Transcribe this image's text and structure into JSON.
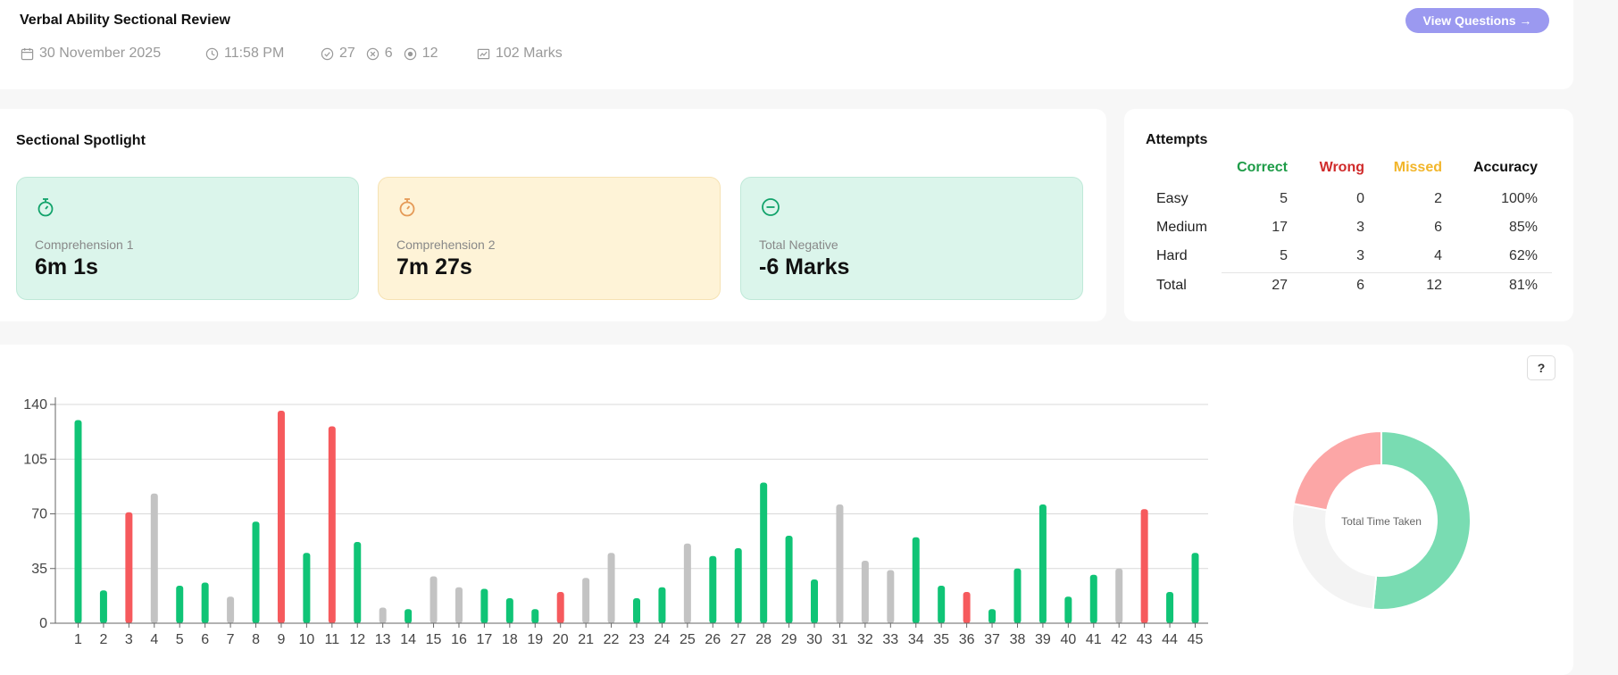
{
  "header": {
    "title": "Verbal Ability Sectional Review",
    "view_button": "View Questions →",
    "date": "30 November 2025",
    "time": "11:58 PM",
    "correct_count": "27",
    "wrong_count": "6",
    "missed_count": "12",
    "marks": "102 Marks"
  },
  "spotlight": {
    "title": "Sectional Spotlight",
    "cards": [
      {
        "label": "Comprehension 1",
        "value": "6m 1s",
        "icon": "stopwatch-icon",
        "color": "#12a36b"
      },
      {
        "label": "Comprehension 2",
        "value": "7m 27s",
        "icon": "stopwatch-icon",
        "color": "#e59a57"
      },
      {
        "label": "Total Negative",
        "value": "-6 Marks",
        "icon": "minus-circle-icon",
        "color": "#12a36b"
      }
    ]
  },
  "attempts": {
    "title": "Attempts",
    "columns": [
      "Correct",
      "Wrong",
      "Missed",
      "Accuracy"
    ],
    "column_colors": [
      "#1e9c48",
      "#d02b2b",
      "#f2b52a",
      "#111111"
    ],
    "rows": [
      {
        "label": "Easy",
        "correct": "5",
        "wrong": "0",
        "missed": "2",
        "accuracy": "100%"
      },
      {
        "label": "Medium",
        "correct": "17",
        "wrong": "3",
        "missed": "6",
        "accuracy": "85%"
      },
      {
        "label": "Hard",
        "correct": "5",
        "wrong": "3",
        "missed": "4",
        "accuracy": "62%"
      },
      {
        "label": "Total",
        "correct": "27",
        "wrong": "6",
        "missed": "12",
        "accuracy": "81%"
      }
    ]
  },
  "help_button": "?",
  "chart_data": [
    {
      "type": "bar",
      "categories": [
        "1",
        "2",
        "3",
        "4",
        "5",
        "6",
        "7",
        "8",
        "9",
        "10",
        "11",
        "12",
        "13",
        "14",
        "15",
        "16",
        "17",
        "18",
        "19",
        "20",
        "21",
        "22",
        "23",
        "24",
        "25",
        "26",
        "27",
        "28",
        "29",
        "30",
        "31",
        "32",
        "33",
        "34",
        "35",
        "36",
        "37",
        "38",
        "39",
        "40",
        "41",
        "42",
        "43",
        "44",
        "45"
      ],
      "values": [
        130,
        21,
        71,
        83,
        24,
        26,
        17,
        65,
        136,
        45,
        126,
        52,
        10,
        9,
        30,
        23,
        22,
        16,
        9,
        20,
        29,
        45,
        16,
        23,
        51,
        43,
        48,
        90,
        56,
        28,
        76,
        40,
        34,
        55,
        24,
        20,
        9,
        35,
        76,
        17,
        31,
        35,
        73,
        20,
        45
      ],
      "status": [
        "correct",
        "correct",
        "wrong",
        "missed",
        "correct",
        "correct",
        "missed",
        "correct",
        "wrong",
        "correct",
        "wrong",
        "correct",
        "missed",
        "correct",
        "missed",
        "missed",
        "correct",
        "correct",
        "correct",
        "wrong",
        "missed",
        "missed",
        "correct",
        "correct",
        "missed",
        "correct",
        "correct",
        "correct",
        "correct",
        "correct",
        "missed",
        "missed",
        "missed",
        "correct",
        "correct",
        "wrong",
        "correct",
        "correct",
        "correct",
        "correct",
        "correct",
        "missed",
        "wrong",
        "correct",
        "correct"
      ],
      "ylim": [
        0,
        140
      ],
      "yticks": [
        0,
        35,
        70,
        105,
        140
      ],
      "grid": true,
      "colors": {
        "correct": "#10c476",
        "wrong": "#f65a5d",
        "missed": "#c3c3c3"
      }
    },
    {
      "type": "pie",
      "center_label": "Total Time Taken",
      "slices": [
        {
          "status": "correct",
          "value": 0.515,
          "color": "#79dcb2"
        },
        {
          "status": "missed",
          "value": 0.265,
          "color": "#f3f3f3"
        },
        {
          "status": "wrong",
          "value": 0.22,
          "color": "#fca6a6"
        }
      ]
    }
  ]
}
